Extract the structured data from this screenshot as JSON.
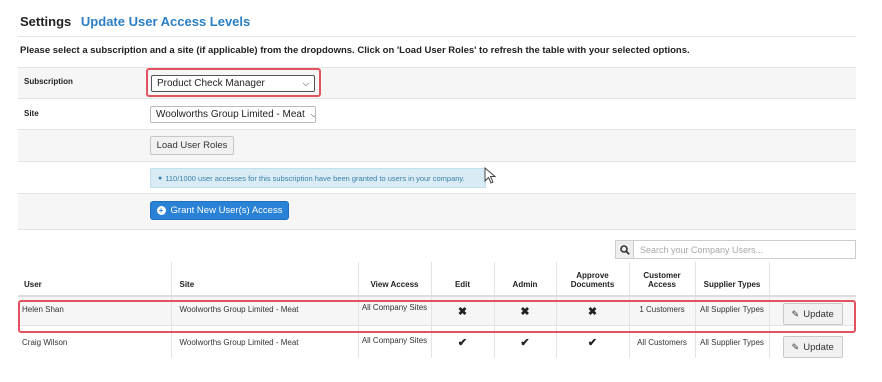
{
  "header": {
    "title": "Settings",
    "subtitle": "Update User Access Levels"
  },
  "intro_text": "Please select a subscription and a site (if applicable) from the dropdowns. Click on 'Load User Roles' to refresh the table with your selected options.",
  "form": {
    "subscription_label": "Subscription",
    "subscription_value": "Product Check Manager",
    "site_label": "Site",
    "site_value": "Woolworths Group Limited - Meat",
    "load_button": "Load User Roles",
    "info_text": "110/1000 user accesses for this subscription have been granted to users in your company.",
    "grant_button": "Grant New User(s) Access"
  },
  "search": {
    "placeholder": "Search your Company Users..."
  },
  "table": {
    "headers": [
      "User",
      "Site",
      "View Access",
      "Edit",
      "Admin",
      "Approve Documents",
      "Customer Access",
      "Supplier Types",
      ""
    ],
    "rows": [
      {
        "user": "Helen Shan",
        "site": "Woolworths Group Limited - Meat",
        "view_access": "All Company Sites",
        "edit": "cross",
        "admin": "cross",
        "approve": "cross",
        "customer_access": "1 Customers",
        "supplier_types": "All Supplier Types",
        "action": "Update"
      },
      {
        "user": "Craig Wilson",
        "site": "Woolworths Group Limited - Meat",
        "view_access": "All Company Sites",
        "edit": "check",
        "admin": "check",
        "approve": "check",
        "customer_access": "All Customers",
        "supplier_types": "All Supplier Types",
        "action": "Update"
      }
    ]
  },
  "icons": {
    "user": "user-icon",
    "plus": "plus-circle-icon",
    "search": "search-icon",
    "edit": "edit-icon",
    "check": "check-icon",
    "cross": "cross-icon"
  },
  "colors": {
    "accent": "#2a82d6",
    "highlight": "#e0545f",
    "info_bg": "#d9ecf6"
  }
}
